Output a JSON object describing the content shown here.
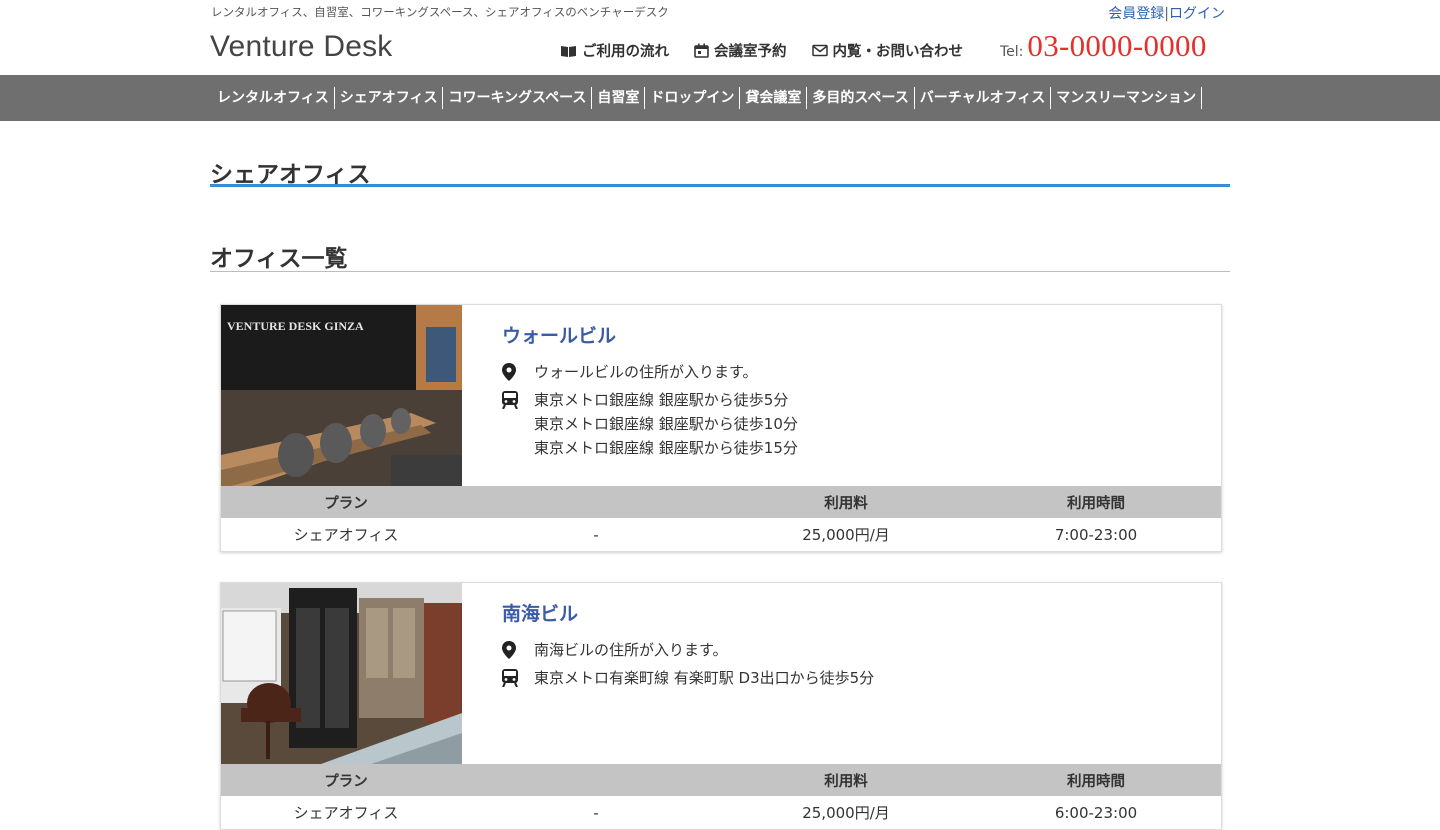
{
  "header": {
    "tagline": "レンタルオフィス、自習室、コワーキングスペース、シェアオフィスのベンチャーデスク",
    "register_link": "会員登録",
    "separator": "|",
    "login_link": "ログイン",
    "logo": "Venture Desk",
    "links": [
      {
        "label": "ご利用の流れ",
        "icon": "book-icon"
      },
      {
        "label": "会議室予約",
        "icon": "calendar-icon"
      },
      {
        "label": "内覧・お問い合わせ",
        "icon": "mail-icon"
      }
    ],
    "tel_label": "Tel:",
    "tel_number": "03-0000-0000",
    "tel_color": "#e5302b"
  },
  "nav": {
    "items": [
      "レンタルオフィス",
      "シェアオフィス",
      "コワーキングスペース",
      "自習室",
      "ドロップイン",
      "貸会議室",
      "多目的スペース",
      "バーチャルオフィス",
      "マンスリーマンション"
    ],
    "bg_color": "#6f6f6f"
  },
  "page": {
    "title": "シェアオフィス",
    "accent_color": "#3a8bd3",
    "section_title": "オフィス一覧"
  },
  "offices": [
    {
      "name": "ウォールビル",
      "address": "ウォールビルの住所が入ります。",
      "access": [
        "東京メトロ銀座線 銀座駅から徒歩5分",
        "東京メトロ銀座線 銀座駅から徒歩10分",
        "東京メトロ銀座線 銀座駅から徒歩15分"
      ],
      "image_sign": "VENTURE DESK GINZA",
      "table_headers": [
        "プラン",
        "",
        "利用料",
        "利用時間"
      ],
      "plans": [
        {
          "name": "シェアオフィス",
          "note": "-",
          "price": "25,000円/月",
          "hours": "7:00-23:00"
        }
      ]
    },
    {
      "name": "南海ビル",
      "address": "南海ビルの住所が入ります。",
      "access": [
        "東京メトロ有楽町線 有楽町駅 D3出口から徒歩5分"
      ],
      "table_headers": [
        "プラン",
        "",
        "利用料",
        "利用時間"
      ],
      "plans": [
        {
          "name": "シェアオフィス",
          "note": "-",
          "price": "25,000円/月",
          "hours": "6:00-23:00"
        }
      ]
    }
  ]
}
